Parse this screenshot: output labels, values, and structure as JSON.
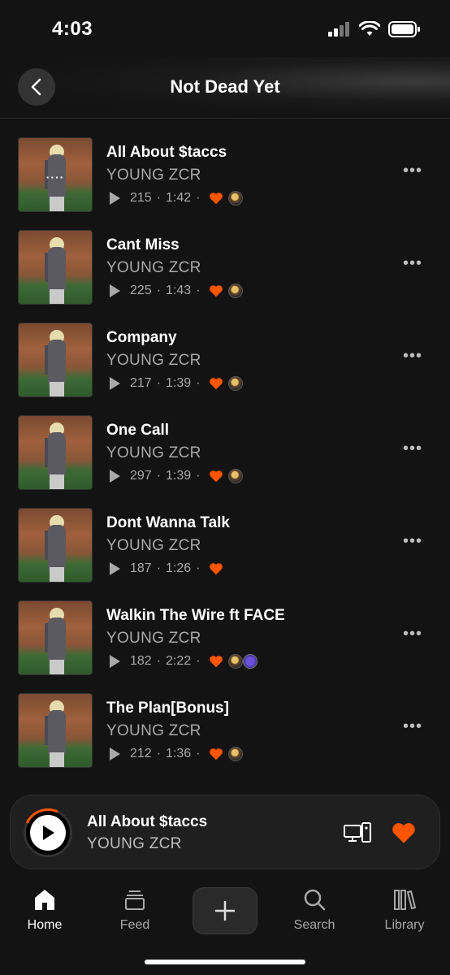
{
  "status_bar": {
    "time": "4:03"
  },
  "header": {
    "title": "Not Dead Yet"
  },
  "tracks": [
    {
      "title": "All About $taccs",
      "artist": "YOUNG ZCR",
      "plays": "215",
      "duration": "1:42",
      "now_playing": true
    },
    {
      "title": "Cant Miss",
      "artist": "YOUNG ZCR",
      "plays": "225",
      "duration": "1:43"
    },
    {
      "title": "Company",
      "artist": "YOUNG ZCR",
      "plays": "217",
      "duration": "1:39"
    },
    {
      "title": "One Call",
      "artist": "YOUNG ZCR",
      "plays": "297",
      "duration": "1:39"
    },
    {
      "title": "Dont Wanna Talk",
      "artist": "YOUNG ZCR",
      "plays": "187",
      "duration": "1:26"
    },
    {
      "title": "Walkin The Wire ft FACE",
      "artist": "YOUNG ZCR",
      "plays": "182",
      "duration": "2:22"
    },
    {
      "title": "The Plan[Bonus]",
      "artist": "YOUNG ZCR",
      "plays": "212",
      "duration": "1:36"
    }
  ],
  "mini_player": {
    "title": "All About $taccs",
    "artist": "YOUNG ZCR"
  },
  "tabs": {
    "home": "Home",
    "feed": "Feed",
    "search": "Search",
    "library": "Library"
  },
  "colors": {
    "accent": "#ff5500",
    "background": "#131313"
  }
}
